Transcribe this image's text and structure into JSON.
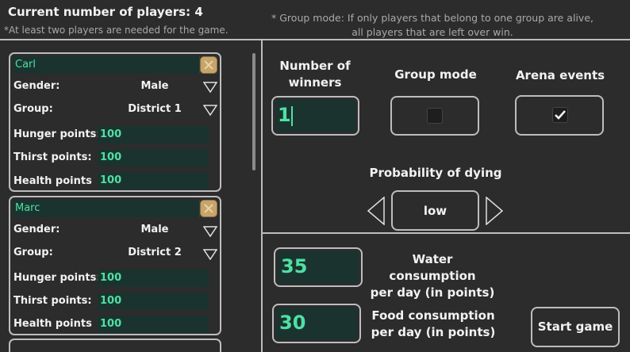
{
  "header": {
    "player_count": "Current number of players: 4",
    "min_players_note": "*At least two players are needed for the game.",
    "group_mode_note_line1": "* Group mode: If only players that belong to one group are alive,",
    "group_mode_note_line2": "all players that are left over win."
  },
  "players": [
    {
      "name": "Carl",
      "gender_label": "Gender:",
      "gender": "Male",
      "group_label": "Group:",
      "group": "District 1",
      "hunger_label": "Hunger points:",
      "hunger": "100",
      "thirst_label": "Thirst points:",
      "thirst": "100",
      "health_label": "Health points",
      "health": "100"
    },
    {
      "name": "Marc",
      "gender_label": "Gender:",
      "gender": "Male",
      "group_label": "Group:",
      "group": "District 2",
      "hunger_label": "Hunger points:",
      "hunger": "100",
      "thirst_label": "Thirst points:",
      "thirst": "100",
      "health_label": "Health points",
      "health": "100"
    }
  ],
  "settings": {
    "winners_label_1": "Number of",
    "winners_label_2": "winners",
    "winners_value": "1",
    "group_mode_label": "Group mode",
    "group_mode_checked": false,
    "arena_events_label": "Arena events",
    "arena_events_checked": true,
    "dying_label": "Probability of dying",
    "dying_value": "low",
    "water_value": "35",
    "water_label_1": "Water consumption",
    "water_label_2": "per day (in points)",
    "food_value": "30",
    "food_label_1": "Food consumption",
    "food_label_2": "per day (in points)",
    "start_button": "Start game"
  },
  "colors": {
    "background": "#2c2c2c",
    "field": "#1b332f",
    "field_text": "#4fe0a4",
    "border": "#bdbdbd",
    "close_button": "#c7a46b"
  },
  "icons": [
    "close-icon",
    "chevron-down-icon",
    "arrow-left-icon",
    "arrow-right-icon",
    "checkmark-icon"
  ]
}
